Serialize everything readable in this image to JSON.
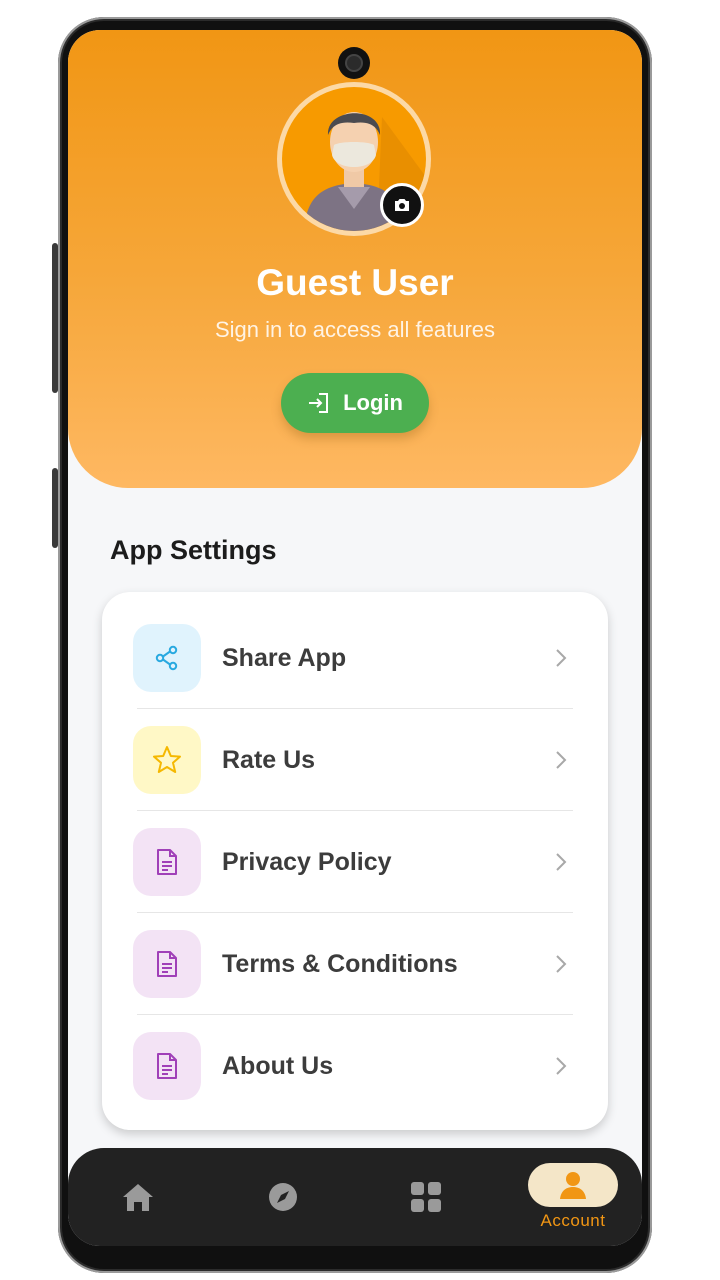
{
  "profile": {
    "name": "Guest User",
    "subtitle": "Sign in to access all features",
    "login_label": "Login"
  },
  "settings": {
    "title": "App Settings",
    "items": [
      {
        "label": "Share App",
        "icon": "share-icon",
        "icon_color": "#29a9e0",
        "icon_bg": "#e0f3fd"
      },
      {
        "label": "Rate Us",
        "icon": "star-icon",
        "icon_color": "#f5b800",
        "icon_bg": "#fff8c6"
      },
      {
        "label": "Privacy Policy",
        "icon": "document-icon",
        "icon_color": "#a040b8",
        "icon_bg": "#f3e3f5"
      },
      {
        "label": "Terms & Conditions",
        "icon": "document-icon",
        "icon_color": "#a040b8",
        "icon_bg": "#f3e3f5"
      },
      {
        "label": "About Us",
        "icon": "document-icon",
        "icon_color": "#a040b8",
        "icon_bg": "#f3e3f5"
      }
    ]
  },
  "nav": {
    "items": [
      {
        "icon": "home-icon"
      },
      {
        "icon": "compass-icon"
      },
      {
        "icon": "grid-icon"
      },
      {
        "icon": "person-icon",
        "label": "Account",
        "active": true
      }
    ]
  },
  "colors": {
    "accent": "#f19614",
    "login_green": "#4caf50",
    "nav_bg": "#222222"
  }
}
